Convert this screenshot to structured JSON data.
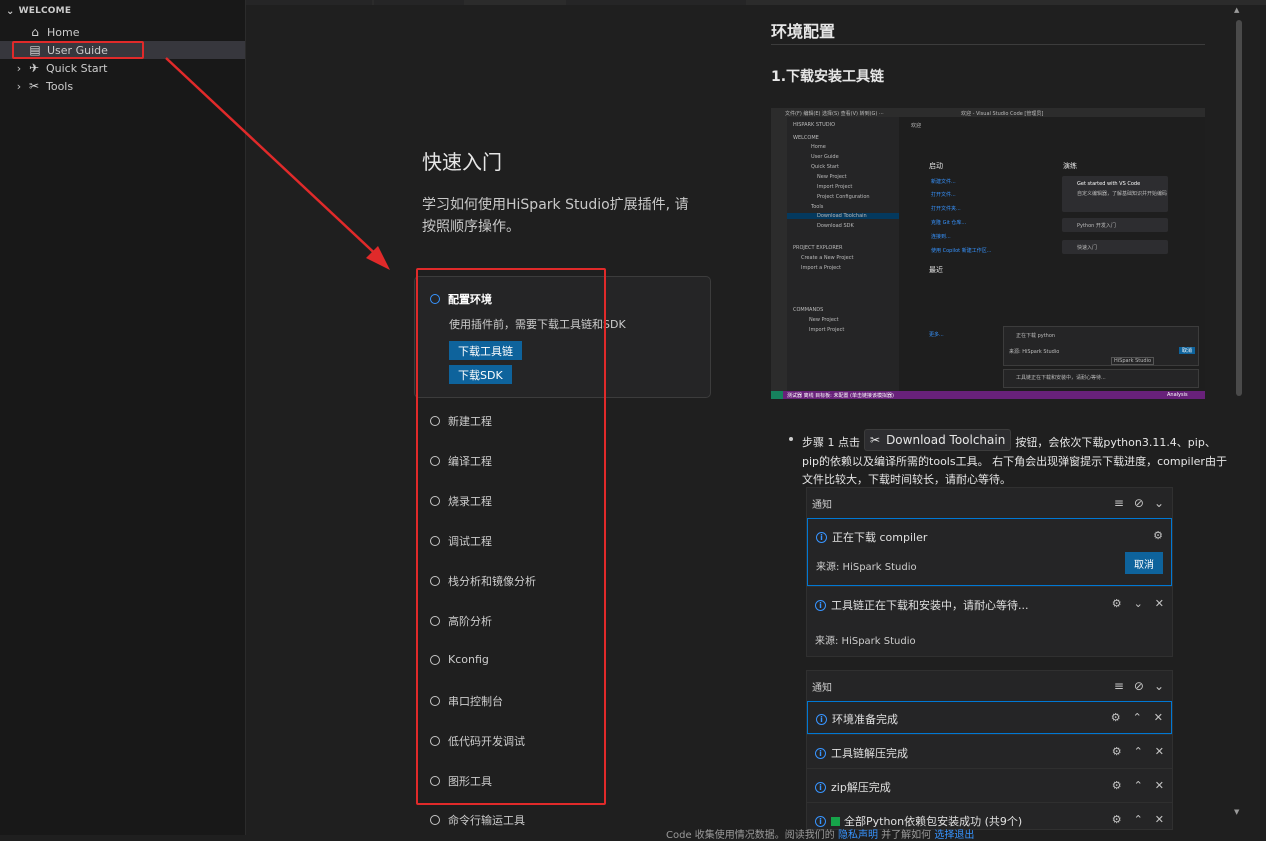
{
  "sidebar": {
    "section_title": "WELCOME",
    "items": [
      {
        "label": "Home",
        "icon": "home-icon"
      },
      {
        "label": "User Guide",
        "icon": "book-icon"
      },
      {
        "label": "Quick Start",
        "icon": "rocket-icon"
      },
      {
        "label": "Tools",
        "icon": "tools-icon"
      }
    ]
  },
  "walkthrough": {
    "title": "快速入门",
    "description": "学习如何使用HiSpark Studio扩展插件, 请按照顺序操作。",
    "active_step": {
      "label": "配置环境",
      "description": "使用插件前，需要下载工具链和SDK",
      "buttons": [
        "下载工具链",
        "下载SDK"
      ]
    },
    "steps": [
      "新建工程",
      "编译工程",
      "烧录工程",
      "调试工程",
      "栈分析和镜像分析",
      "高阶分析",
      "Kconfig",
      "串口控制台",
      "低代码开发调试",
      "图形工具",
      "命令行输运工具"
    ]
  },
  "doc": {
    "h1": "环境配置",
    "h2": "1.下载安装工具链",
    "mini_screenshot": {
      "title": "欢迎 - Visual Studio Code [管理员]",
      "menu": "文件(F)  编辑(E)  选择(S)  查看(V)  转到(G)  ···",
      "side_header": "HISPARK STUDIO",
      "welcome": "WELCOME",
      "tree": [
        "Home",
        "User Guide",
        "Quick Start",
        "New Project",
        "Import Project",
        "Project Configuration",
        "Tools",
        "Download Toolchain",
        "Download SDK"
      ],
      "project_explorer": "PROJECT EXPLORER",
      "pe_items": [
        "Create a New Project",
        "Import a Project"
      ],
      "commands": "COMMANDS",
      "cmd_items": [
        "New Project",
        "Import Project"
      ],
      "tab": "欢迎",
      "start_heading": "启动",
      "start_items": [
        "新建文件...",
        "打开文件...",
        "打开文件夹...",
        "克隆 Git 仓库...",
        "连接到...",
        "使用 Copilot 新建工作区..."
      ],
      "recent_heading": "最近",
      "more": "更多...",
      "walk_heading": "演练",
      "walk_items": [
        "Get started with VS Code",
        "自定义编辑器，了解基础知识并开始编码",
        "Python 开发入门",
        "快速入门"
      ],
      "notif1": "正在下载 python",
      "notif1_src": "来源: HiSpark Studio",
      "notif1_btn": "取消",
      "tooltip": "HiSpark Studio",
      "notif2": "工具链正在下载和安装中，请耐心等待...",
      "status_left": "测试器 离线  目标板: 未配置 (单击链接该模拟器)",
      "status_right": "Analysis"
    },
    "bullet": {
      "prefix": "步骤 1 点击",
      "chip_label": "Download Toolchain",
      "suffix": "按钮，会依次下载python3.11.4、pip、",
      "line2": "pip的依赖以及编译所需的tools工具。 右下角会出现弹窗提示下载进度，compiler由于",
      "line3": "文件比较大，下载时间较长，请耐心等待。"
    },
    "panel1": {
      "header": "通知",
      "item1": {
        "text": "正在下载 compiler",
        "source": "来源: HiSpark Studio",
        "button": "取消"
      },
      "item2": {
        "text": "工具链正在下载和安装中，请耐心等待...",
        "source": "来源: HiSpark Studio"
      }
    },
    "panel2": {
      "header": "通知",
      "items": [
        "环境准备完成",
        "工具链解压完成",
        "zip解压完成",
        "全部Python依赖包安装成功 (共9个)"
      ]
    }
  },
  "footer": {
    "text": "Code 收集使用情况数据。阅读我们的",
    "link1": "隐私声明",
    "mid": "并了解如何",
    "link2": "选择退出"
  },
  "colors": {
    "accent": "#0e639c",
    "annotation": "#e02a2a",
    "focus": "#0078d4"
  }
}
